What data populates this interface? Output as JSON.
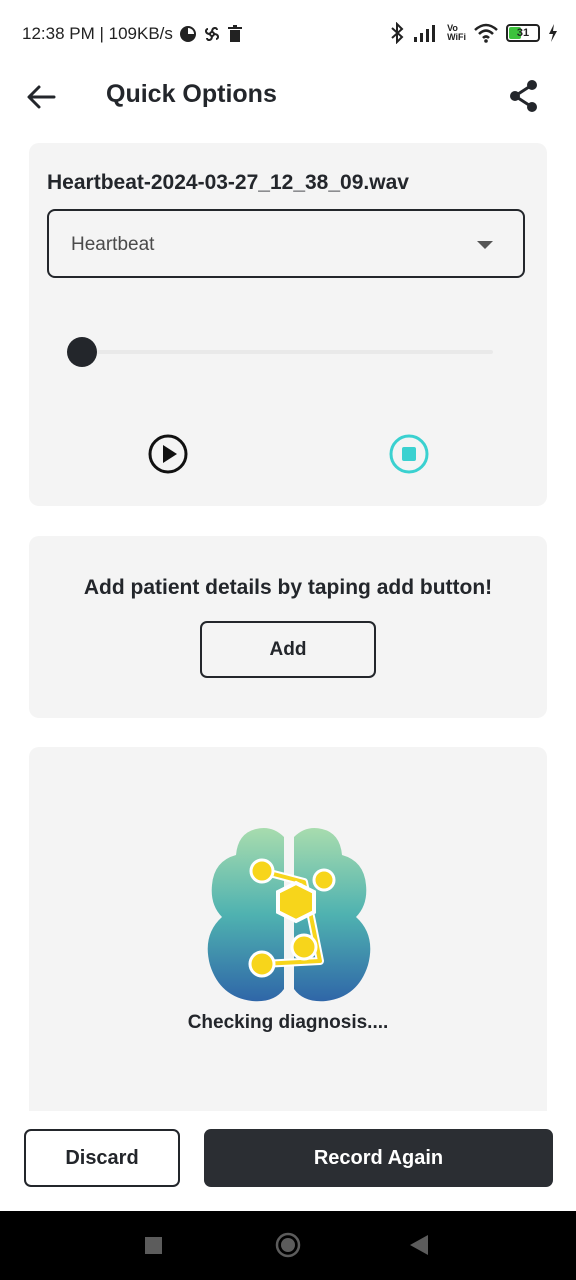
{
  "status_bar": {
    "time_speed": "12:38 PM | 109KB/s",
    "vowifi_top": "Vo",
    "vowifi_bottom": "WiFi",
    "battery": "31"
  },
  "app_bar": {
    "title": "Quick Options"
  },
  "recording": {
    "filename": "Heartbeat-2024-03-27_12_38_09.wav",
    "category_selected": "Heartbeat",
    "playback_progress": 0
  },
  "patient": {
    "prompt": "Add patient details by taping add button!",
    "add_label": "Add"
  },
  "diagnosis": {
    "status": "Checking diagnosis...."
  },
  "actions": {
    "discard_label": "Discard",
    "record_again_label": "Record Again"
  },
  "colors": {
    "primary_dark": "#2b2e33",
    "accent_teal": "#3ad1d0",
    "card_bg": "#f4f4f4",
    "logo_yellow": "#f7d51b"
  }
}
